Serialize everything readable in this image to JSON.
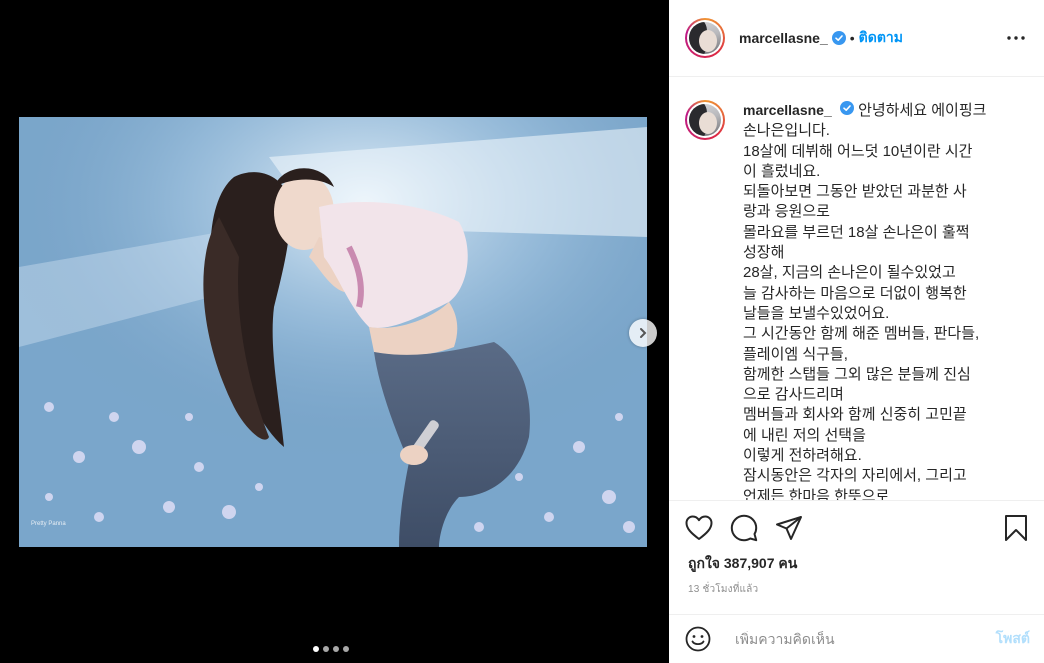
{
  "post": {
    "username": "marcellasne_",
    "follow_label": "ติดตาม",
    "separator": "•",
    "caption_lines": [
      "안녕하세요 에이핑크",
      "손나은입니다.",
      "18살에 데뷔해 어느덧 10년이란 시간",
      "이 흘렀네요.",
      "되돌아보면 그동안 받았던 과분한 사",
      "랑과 응원으로",
      "몰라요를 부르던 18살 손나은이 훌쩍",
      "성장해",
      "28살, 지금의 손나은이 될수있었고",
      "늘 감사하는 마음으로 더없이 행복한",
      "날들을 보낼수있었어요.",
      "그 시간동안 함께 해준 멤버들, 판다들,",
      "플레이엠 식구들,",
      "함께한 스탭들 그외 많은 분들께 진심",
      "으로 감사드리며",
      "멤버들과 회사와 함께 신중히 고민끝",
      "에 내린 저의 선택을",
      "이렇게 전하려해요.",
      "잠시동안은 각자의 자리에서, 그리고",
      "언제든 한마음 한뜻으로"
    ],
    "likes_text": "ถูกใจ 387,907 คน",
    "time_text": "13 ชั่วโมงที่แล้ว",
    "comment_placeholder": "เพิ่มความคิดเห็น",
    "post_button": "โพสต์",
    "carousel": {
      "total": 4,
      "active": 1
    }
  },
  "icons": {
    "verified": "verified-badge-icon",
    "more": "more-options-icon",
    "like": "heart-icon",
    "comment": "comment-icon",
    "share": "share-icon",
    "save": "bookmark-icon",
    "emoji": "emoji-icon",
    "next": "chevron-right-icon"
  },
  "colors": {
    "link": "#0095f6",
    "post_disabled": "#b2dffc",
    "verified": "#3897f0",
    "muted": "#8e8e8e"
  }
}
